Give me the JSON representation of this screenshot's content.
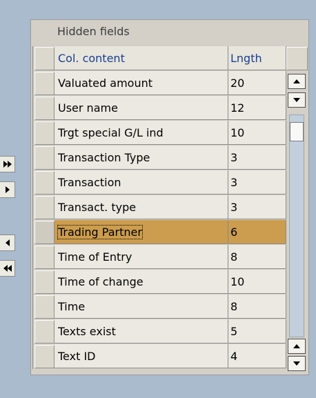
{
  "panel": {
    "title": "Hidden fields"
  },
  "table": {
    "headers": {
      "col_content": "Col. content",
      "length": "Lngth"
    },
    "rows": [
      {
        "content": "Valuated amount",
        "length": "20"
      },
      {
        "content": "User name",
        "length": "12"
      },
      {
        "content": "Trgt special G/L ind",
        "length": "10"
      },
      {
        "content": "Transaction Type",
        "length": "3"
      },
      {
        "content": "Transaction",
        "length": "3"
      },
      {
        "content": "Transact. type",
        "length": "3"
      },
      {
        "content": "Trading Partner",
        "length": "6"
      },
      {
        "content": "Time of Entry",
        "length": "8"
      },
      {
        "content": "Time of change",
        "length": "10"
      },
      {
        "content": "Time",
        "length": "8"
      },
      {
        "content": "Texts exist",
        "length": "5"
      },
      {
        "content": "Text ID",
        "length": "4"
      }
    ],
    "selected_row": "Trading Partner"
  },
  "colors": {
    "background": "#a9bbcd",
    "header_text": "#1a3f91",
    "selected_row": "#cc9d4e"
  },
  "icons": {
    "move_all_right": "double-arrow-right-icon",
    "move_right": "arrow-right-icon",
    "move_left": "arrow-left-icon",
    "move_all_left": "double-arrow-left-icon"
  }
}
